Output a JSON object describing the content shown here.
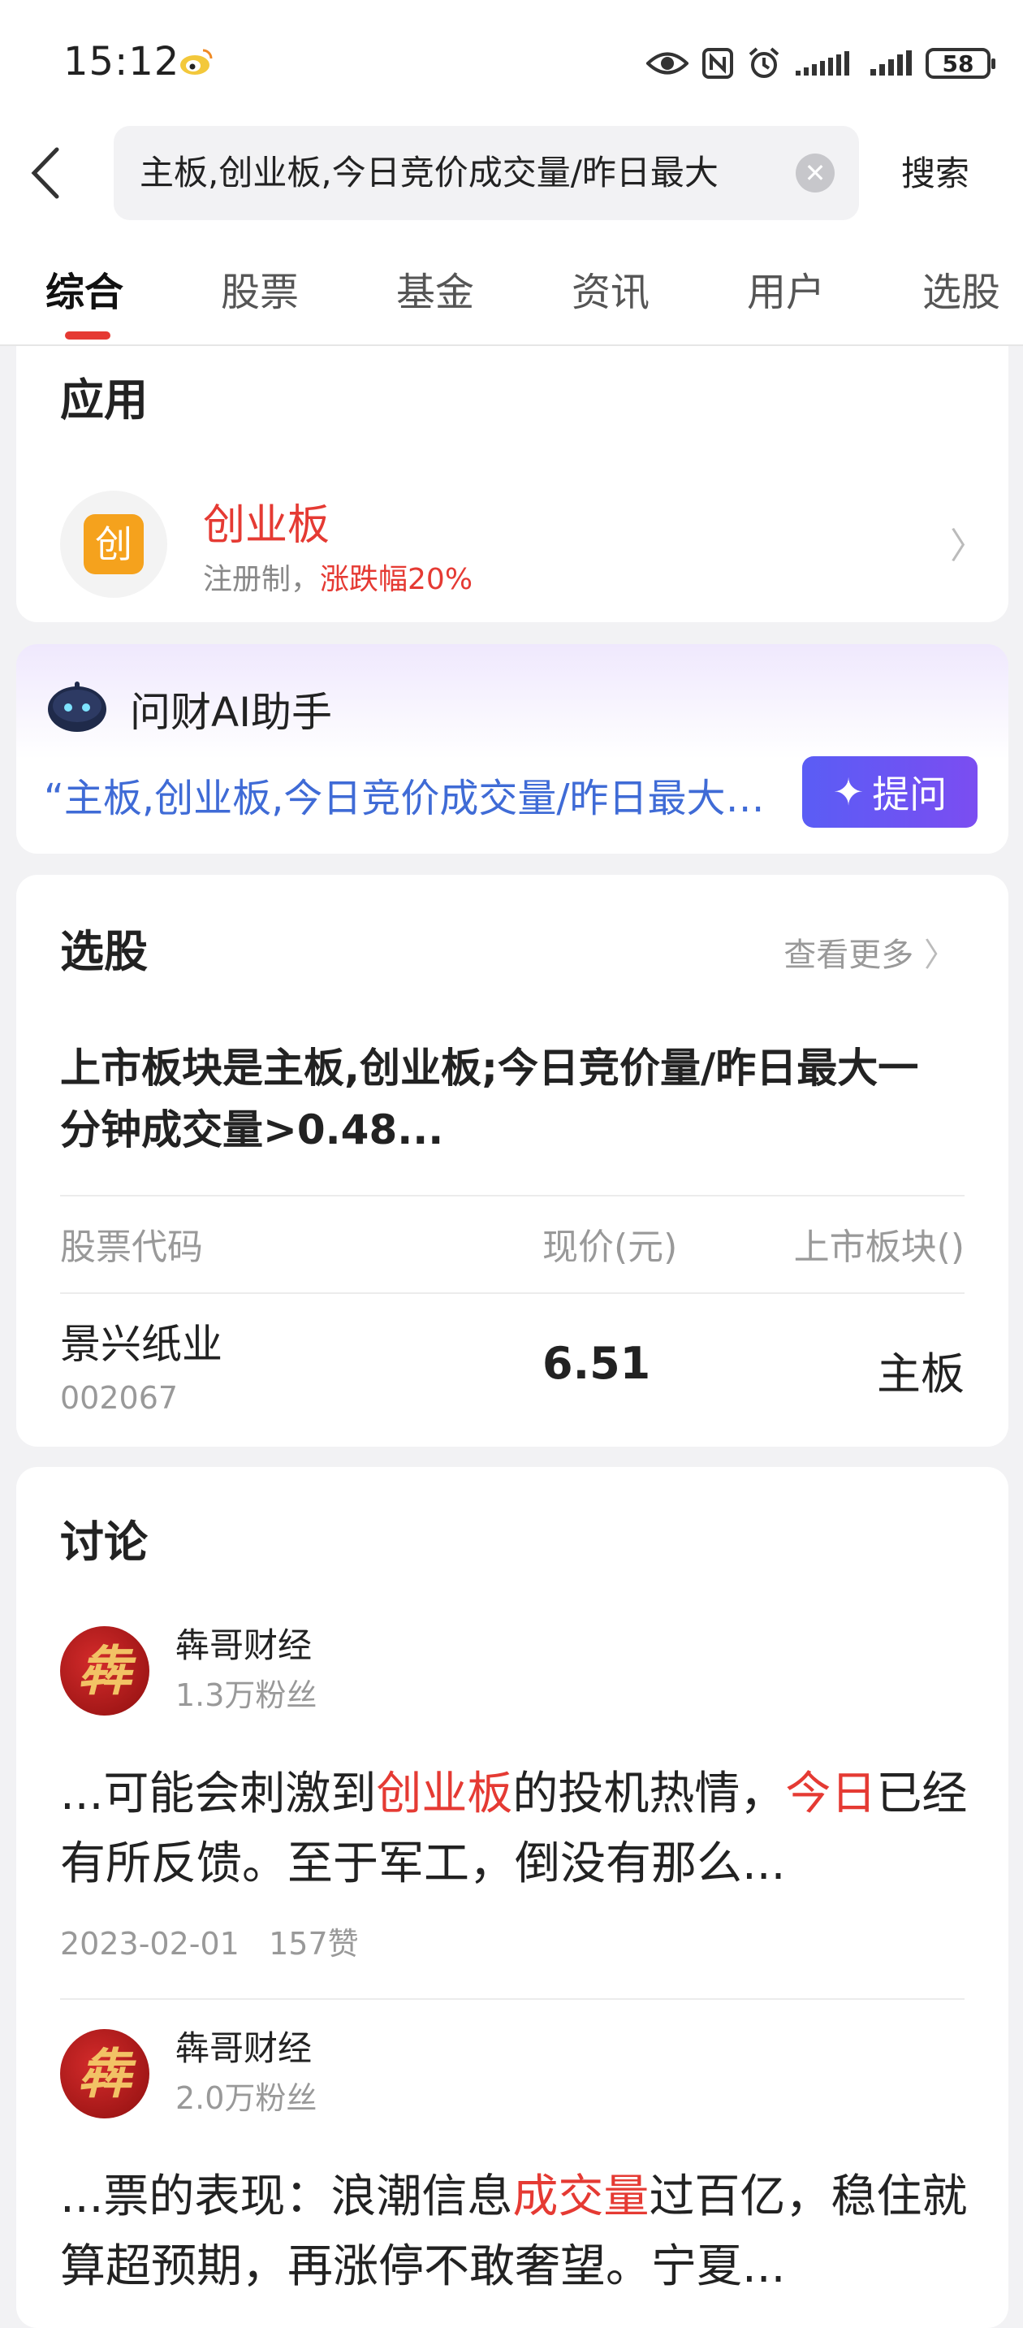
{
  "status_bar": {
    "time": "15:12",
    "battery": "58"
  },
  "search": {
    "query": "主板,创业板,今日竞价成交量/昨日最大",
    "clear_icon": "close-circle-icon",
    "submit_label": "搜索"
  },
  "tabs": [
    {
      "label": "综合",
      "active": true
    },
    {
      "label": "股票",
      "active": false
    },
    {
      "label": "基金",
      "active": false
    },
    {
      "label": "资讯",
      "active": false
    },
    {
      "label": "用户",
      "active": false
    },
    {
      "label": "选股",
      "active": false
    }
  ],
  "apps": {
    "section_title": "应用",
    "item": {
      "icon_char": "创",
      "name": "创业板",
      "desc_prefix": "注册制，",
      "desc_highlight": "涨跌",
      "desc_suffix": "幅20%"
    }
  },
  "ai": {
    "title": "问财AI助手",
    "question": "“主板,创业板,今日竞价成交量/昨日最大一分钟成交量>0.48",
    "ask_label": "提问"
  },
  "screener": {
    "title": "选股",
    "more": "查看更多",
    "condition": "上市板块是主板,创业板;今日竞价量/昨日最大一分钟成交量>0.48...",
    "headers": [
      "股票代码",
      "现价(元)",
      "上市板块()"
    ],
    "rows": [
      {
        "name": "景兴纸业",
        "code": "002067",
        "price": "6.51",
        "board": "主板"
      }
    ]
  },
  "discussion": {
    "title": "讨论",
    "posts": [
      {
        "author": "犇哥财经",
        "fans": "1.3万粉丝",
        "text_1": "...可能会刺激到",
        "hl_1": "创业板",
        "text_2": "的投机热情，",
        "hl_2": "今日",
        "text_3": "已经有所反馈。至于军工，倒没有那么...",
        "date": "2023-02-01",
        "likes": "157赞"
      },
      {
        "author": "犇哥财经",
        "fans": "2.0万粉丝",
        "text_1": "...票的表现：浪潮信息",
        "hl_1": "成交量",
        "text_2": "过百亿，稳住就算超预期，再涨停不敢奢望。宁夏...",
        "avatar_char": "犇"
      }
    ]
  },
  "colors": {
    "accent_red": "#e53a33",
    "link_blue": "#3f6bd6",
    "ai_button": "#6a55f3"
  }
}
